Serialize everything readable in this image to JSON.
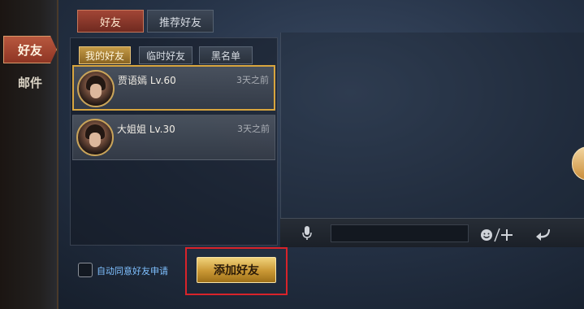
{
  "sidebar": {
    "items": [
      {
        "label": "好友",
        "active": true
      },
      {
        "label": "邮件",
        "active": false
      }
    ]
  },
  "tabs": [
    {
      "label": "好友",
      "active": true
    },
    {
      "label": "推荐好友",
      "active": false
    }
  ],
  "subtabs": [
    {
      "label": "我的好友",
      "active": true
    },
    {
      "label": "临时好友",
      "active": false
    },
    {
      "label": "黑名单",
      "active": false
    }
  ],
  "friends": [
    {
      "name": "贾语嫣 Lv.60",
      "last_seen": "3天之前",
      "selected": true
    },
    {
      "name": "大姐姐 Lv.30",
      "last_seen": "3天之前",
      "selected": false
    }
  ],
  "auto_accept": {
    "label": "自动同意好友申请",
    "checked": false
  },
  "add_friend_button": {
    "label": "添加好友"
  },
  "chat": {
    "input_value": "",
    "icons": [
      "microphone-icon",
      "emoji-icon",
      "plus-icon",
      "send-icon"
    ]
  },
  "colors": {
    "accent_gold": "#d8a53e",
    "active_red": "#a24636",
    "link_blue": "#7fc0ff",
    "highlight_frame": "#d8232a"
  }
}
